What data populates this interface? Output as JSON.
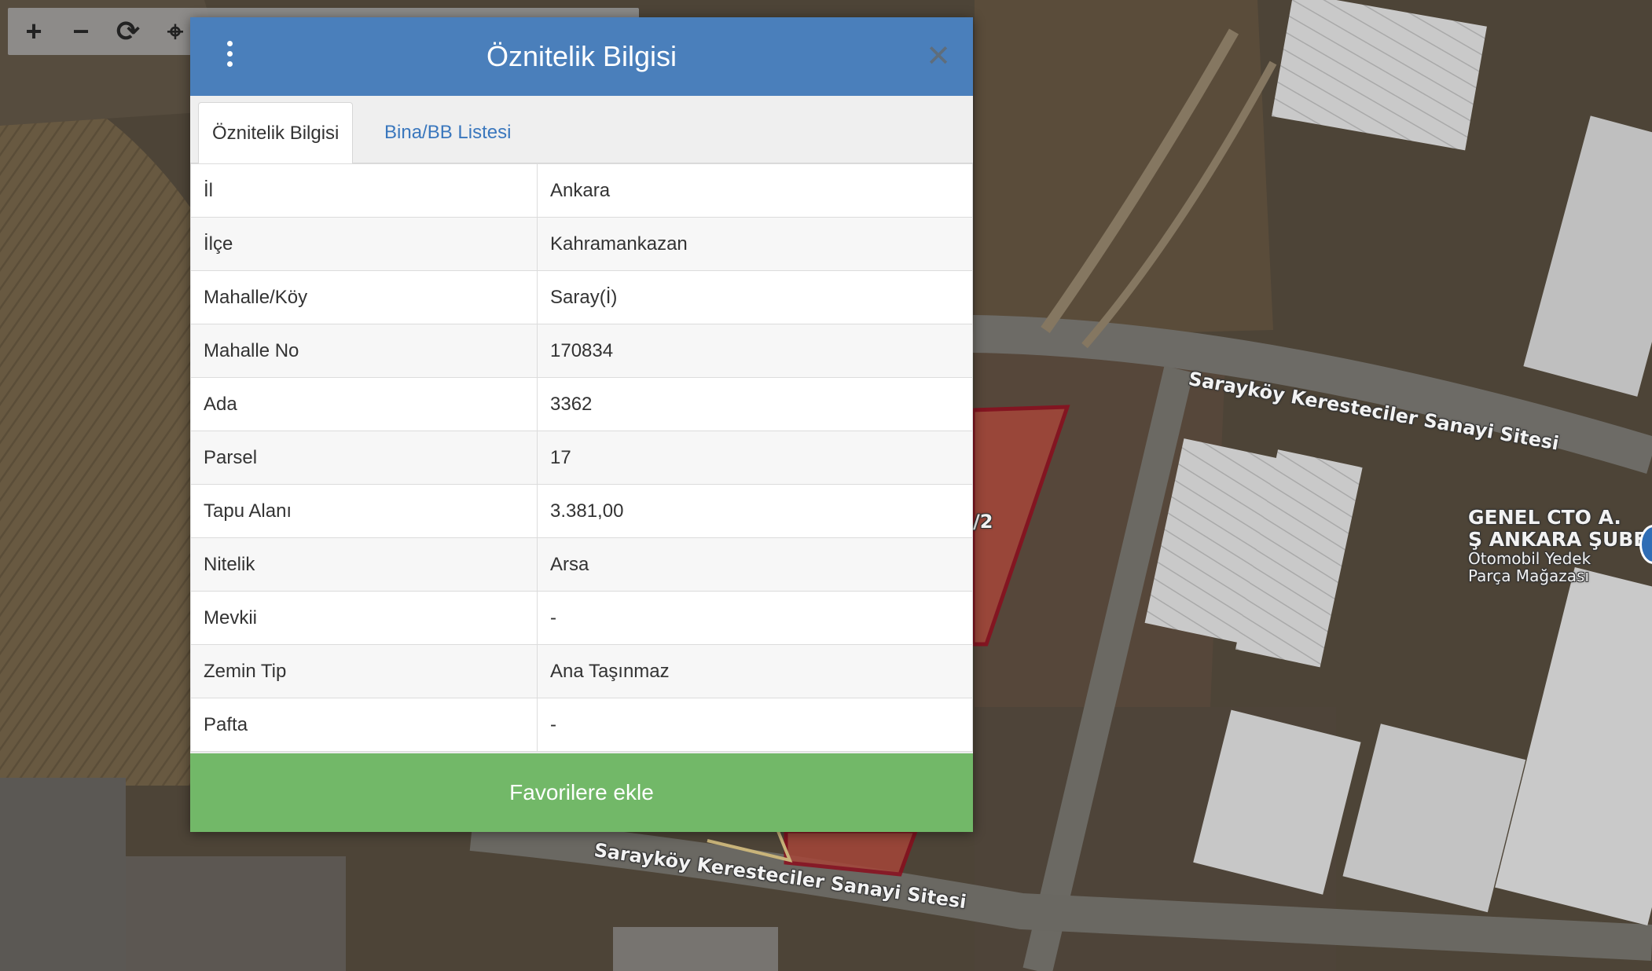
{
  "toolbar": {
    "zoom_in": "+",
    "zoom_out": "−",
    "refresh": "⟳",
    "locate": "⌖",
    "icons": [
      "plus-icon",
      "minus-icon",
      "refresh-icon",
      "crosshair-icon"
    ]
  },
  "map": {
    "road_label_1": "Sarayköy Keresteciler Sanayi Sitesi",
    "road_label_2": "Sarayköy Keresteciler Sanayi Sitesi",
    "parcel_label": "/2",
    "poi_lines": [
      "GENEL CTO A.",
      "Ş ANKARA ŞUBE",
      "Otomobil Yedek",
      "Parça Mağazası"
    ],
    "parcel_outline_color": "#8b0d1d",
    "parcel_fill_color": "#b0443a"
  },
  "dialog": {
    "title": "Öznitelik Bilgisi",
    "menu_icon": "vertical-dots-icon",
    "close_icon": "close-icon",
    "close_label": "✕",
    "header_color": "#4a7fbb",
    "tabs": [
      {
        "label": "Öznitelik Bilgisi",
        "active": true
      },
      {
        "label": "Bina/BB Listesi",
        "active": false
      }
    ],
    "rows": [
      {
        "key": "İl",
        "value": "Ankara"
      },
      {
        "key": "İlçe",
        "value": "Kahramankazan"
      },
      {
        "key": "Mahalle/Köy",
        "value": "Saray(İ)"
      },
      {
        "key": "Mahalle No",
        "value": "170834"
      },
      {
        "key": "Ada",
        "value": "3362"
      },
      {
        "key": "Parsel",
        "value": "17"
      },
      {
        "key": "Tapu Alanı",
        "value": "3.381,00"
      },
      {
        "key": "Nitelik",
        "value": "Arsa"
      },
      {
        "key": "Mevkii",
        "value": "-"
      },
      {
        "key": "Zemin Tip",
        "value": "Ana Taşınmaz"
      },
      {
        "key": "Pafta",
        "value": "-"
      }
    ],
    "favorite_button": "Favorilere ekle",
    "favorite_color": "#72b868"
  }
}
